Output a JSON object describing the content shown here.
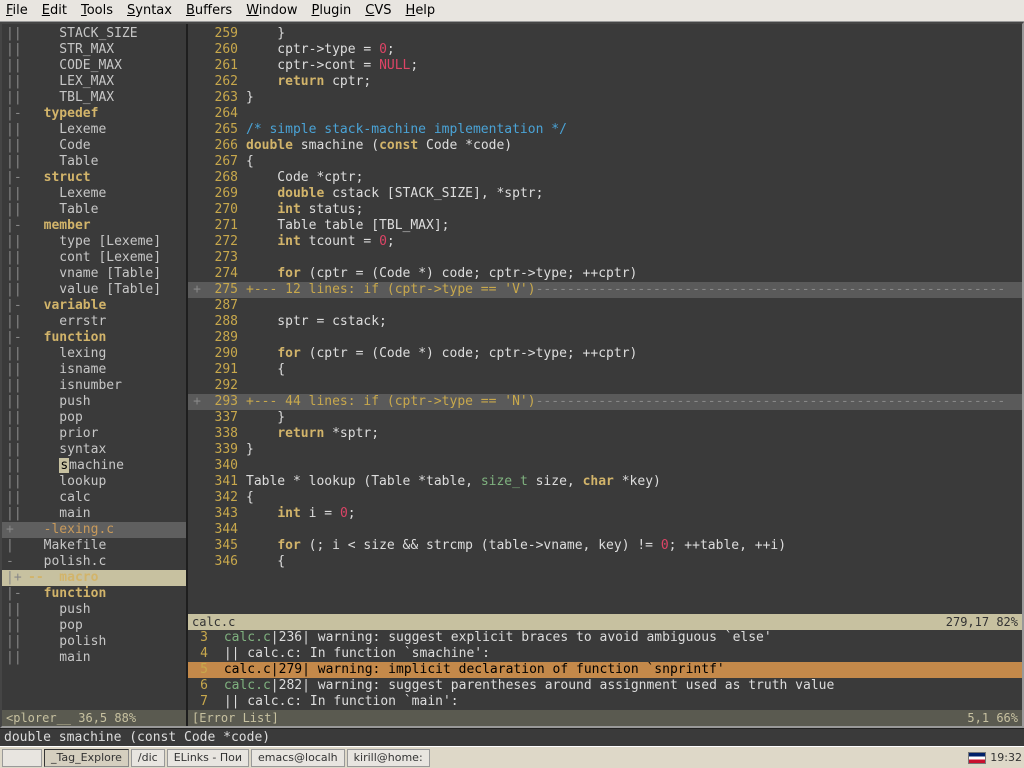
{
  "menu": [
    "File",
    "Edit",
    "Tools",
    "Syntax",
    "Buffers",
    "Window",
    "Plugin",
    "CVS",
    "Help"
  ],
  "outline": [
    {
      "g": "||",
      "t": "    STACK_SIZE",
      "cls": "id"
    },
    {
      "g": "||",
      "t": "    STR_MAX",
      "cls": "id"
    },
    {
      "g": "||",
      "t": "    CODE_MAX",
      "cls": "id"
    },
    {
      "g": "||",
      "t": "    LEX_MAX",
      "cls": "id"
    },
    {
      "g": "||",
      "t": "    TBL_MAX",
      "cls": "id"
    },
    {
      "g": "|-",
      "t": "  typedef",
      "cls": "hdr"
    },
    {
      "g": "||",
      "t": "    Lexeme",
      "cls": "id"
    },
    {
      "g": "||",
      "t": "    Code",
      "cls": "id"
    },
    {
      "g": "||",
      "t": "    Table",
      "cls": "id"
    },
    {
      "g": "|-",
      "t": "  struct",
      "cls": "hdr"
    },
    {
      "g": "||",
      "t": "    Lexeme",
      "cls": "id"
    },
    {
      "g": "||",
      "t": "    Table",
      "cls": "id"
    },
    {
      "g": "|-",
      "t": "  member",
      "cls": "hdr"
    },
    {
      "g": "||",
      "t": "    type [Lexeme]",
      "cls": "id"
    },
    {
      "g": "||",
      "t": "    cont [Lexeme]",
      "cls": "id"
    },
    {
      "g": "||",
      "t": "    vname [Table]",
      "cls": "id"
    },
    {
      "g": "||",
      "t": "    value [Table]",
      "cls": "id"
    },
    {
      "g": "|-",
      "t": "  variable",
      "cls": "hdr"
    },
    {
      "g": "||",
      "t": "    errstr",
      "cls": "id"
    },
    {
      "g": "|-",
      "t": "  function",
      "cls": "hdr"
    },
    {
      "g": "||",
      "t": "    lexing",
      "cls": "id"
    },
    {
      "g": "||",
      "t": "    isname",
      "cls": "id"
    },
    {
      "g": "||",
      "t": "    isnumber",
      "cls": "id"
    },
    {
      "g": "||",
      "t": "    push",
      "cls": "id"
    },
    {
      "g": "||",
      "t": "    pop",
      "cls": "id"
    },
    {
      "g": "||",
      "t": "    prior",
      "cls": "id"
    },
    {
      "g": "||",
      "t": "    syntax",
      "cls": "id"
    },
    {
      "g": "||",
      "t": "    smachine",
      "cls": "id",
      "cur": true
    },
    {
      "g": "||",
      "t": "    lookup",
      "cls": "id"
    },
    {
      "g": "||",
      "t": "    calc",
      "cls": "id"
    },
    {
      "g": "||",
      "t": "    main",
      "cls": "id"
    },
    {
      "g": "+ ",
      "t": "  -lexing.c",
      "cls": "file",
      "hl": true
    },
    {
      "g": "| ",
      "t": "  Makefile",
      "cls": "id"
    },
    {
      "g": "- ",
      "t": "  polish.c",
      "cls": "id"
    },
    {
      "g": "|+",
      "t": "--  macro",
      "cls": "hdr",
      "hl": true,
      "st": true
    },
    {
      "g": "|-",
      "t": "  function",
      "cls": "hdr"
    },
    {
      "g": "||",
      "t": "    push",
      "cls": "id"
    },
    {
      "g": "||",
      "t": "    pop",
      "cls": "id"
    },
    {
      "g": "||",
      "t": "    polish",
      "cls": "id"
    },
    {
      "g": "||",
      "t": "    main",
      "cls": "id"
    }
  ],
  "code": [
    {
      "n": 259,
      "h": "    }"
    },
    {
      "n": 260,
      "h": "    cptr->type = <span class='num'>0</span>;"
    },
    {
      "n": 261,
      "h": "    cptr->cont = <span class='num'>NULL</span>;"
    },
    {
      "n": 262,
      "h": "    <span class='kw'>return</span> cptr;"
    },
    {
      "n": 263,
      "h": "}"
    },
    {
      "n": 264,
      "h": ""
    },
    {
      "n": 265,
      "h": "<span class='cm'>/* simple stack-machine implementation */</span>"
    },
    {
      "n": 266,
      "h": "<span class='kw'>double</span> smachine (<span class='kw'>const</span> Code *code)"
    },
    {
      "n": 267,
      "h": "{"
    },
    {
      "n": 268,
      "h": "    Code *cptr;"
    },
    {
      "n": 269,
      "h": "    <span class='kw'>double</span> cstack [STACK_SIZE], *sptr;"
    },
    {
      "n": 270,
      "h": "    <span class='kw'>int</span> status;"
    },
    {
      "n": 271,
      "h": "    Table table [TBL_MAX];"
    },
    {
      "n": 272,
      "h": "    <span class='kw'>int</span> tcount = <span class='num'>0</span>;"
    },
    {
      "n": 273,
      "h": ""
    },
    {
      "n": 274,
      "h": "    <span class='kw'>for</span> (cptr = (Code *) code; cptr->type; ++cptr)"
    },
    {
      "n": 275,
      "fold": "+--- 12 lines: if (cptr->type == 'V')",
      "f": "+"
    },
    {
      "n": 287,
      "h": ""
    },
    {
      "n": 288,
      "h": "    sptr = cstack;"
    },
    {
      "n": 289,
      "h": ""
    },
    {
      "n": 290,
      "h": "    <span class='kw'>for</span> (cptr = (Code *) code; cptr->type; ++cptr)"
    },
    {
      "n": 291,
      "h": "    {"
    },
    {
      "n": 292,
      "h": ""
    },
    {
      "n": 293,
      "fold": "+--- 44 lines: if (cptr->type == 'N')",
      "f": "+"
    },
    {
      "n": 337,
      "h": "    }"
    },
    {
      "n": 338,
      "h": "    <span class='kw'>return</span> *sptr;"
    },
    {
      "n": 339,
      "h": "}"
    },
    {
      "n": 340,
      "h": ""
    },
    {
      "n": 341,
      "h": "Table * lookup (Table *table, <span class='ty2'>size_t</span> size, <span class='kw'>char</span> *key)"
    },
    {
      "n": 342,
      "h": "{"
    },
    {
      "n": 343,
      "h": "    <span class='kw'>int</span> i = <span class='num'>0</span>;"
    },
    {
      "n": 344,
      "h": ""
    },
    {
      "n": 345,
      "h": "    <span class='kw'>for</span> (; i &lt; size &amp;&amp; strcmp (table->vname, key) != <span class='num'>0</span>; ++table, ++i)"
    },
    {
      "n": 346,
      "h": "    {"
    }
  ],
  "status_main": {
    "left": "calc.c",
    "right": "279,17          82%"
  },
  "errors": [
    {
      "n": 3,
      "h": "<span class='errfn'>calc.c</span>|236| warning: suggest explicit braces to avoid ambiguous `else'"
    },
    {
      "n": 4,
      "h": "|| calc.c: In function `smachine':"
    },
    {
      "n": 5,
      "h": "calc.c|279| warning: implicit declaration of function `snprintf'",
      "sel": true
    },
    {
      "n": 6,
      "h": "<span class='errfn'>calc.c</span>|282| warning: suggest parentheses around assignment used as truth value"
    },
    {
      "n": 7,
      "h": "|| calc.c: In function `main':"
    }
  ],
  "status_sidebar": {
    "t": "<plorer__ 36,5   88%"
  },
  "status_err": {
    "left": "[Error List]",
    "right": "5,1           66%"
  },
  "cmdline": "double smachine (const Code *code)",
  "taskbar": {
    "items": [
      "",
      "_Tag_Explore",
      "/dic",
      "ELinks - Пои",
      "emacs@localh",
      "kirill@home:"
    ],
    "clock": "19:32"
  }
}
